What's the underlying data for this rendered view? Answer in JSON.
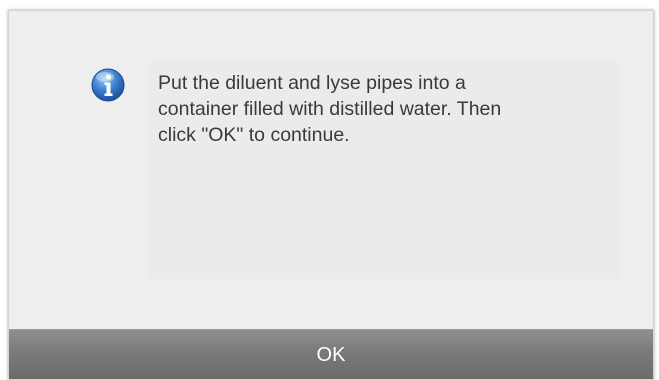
{
  "dialog": {
    "icon": "info-icon",
    "message_lines": [
      "Put the diluent and lyse pipes into a",
      "container filled with distilled water. Then",
      "click \"OK\" to continue."
    ],
    "ok_label": "OK"
  },
  "colors": {
    "background": "#efefef",
    "button": "#7a7a7a",
    "icon_blue": "#2f6fc3",
    "text": "#3a3a3a"
  }
}
